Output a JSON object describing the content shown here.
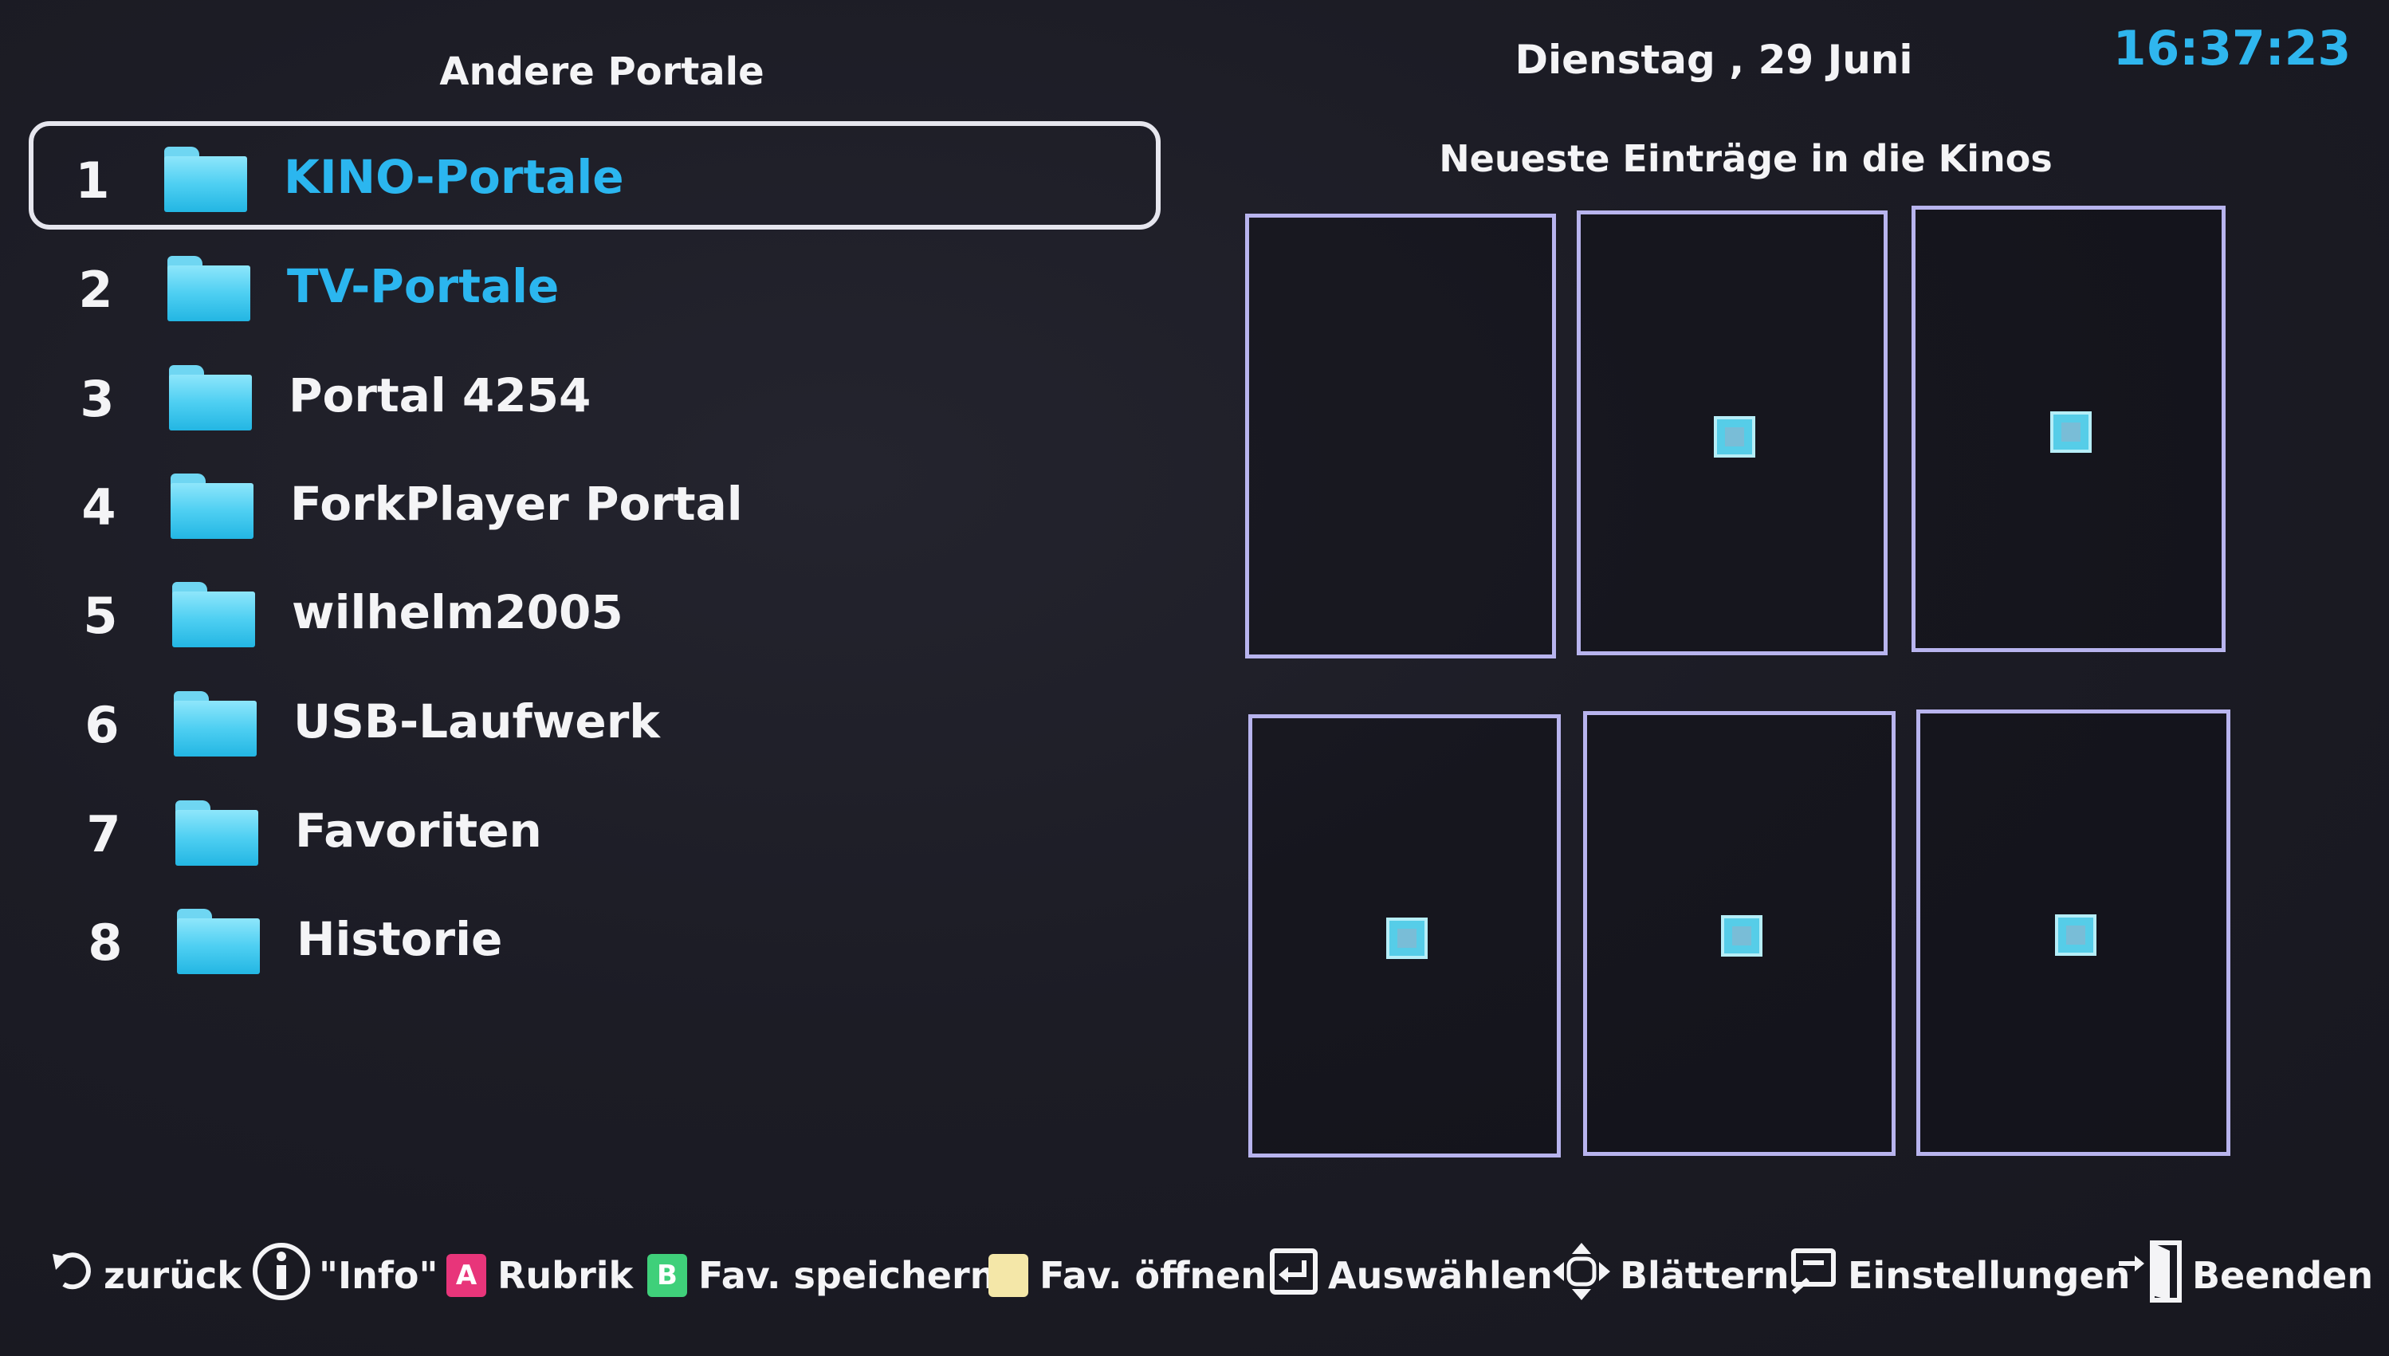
{
  "header": {
    "left_title": "Andere Portale",
    "date": "Dienstag , 29  Juni",
    "time": "16:37:23"
  },
  "list": {
    "items": [
      {
        "number": "1",
        "label": "KINO-Portale",
        "icon": "folder-icon",
        "highlight": true
      },
      {
        "number": "2",
        "label": "TV-Portale",
        "icon": "folder-icon",
        "highlight": true
      },
      {
        "number": "3",
        "label": "Portal 4254",
        "icon": "folder-icon",
        "highlight": false
      },
      {
        "number": "4",
        "label": "ForkPlayer Portal",
        "icon": "folder-icon",
        "highlight": false
      },
      {
        "number": "5",
        "label": "wilhelm2005",
        "icon": "folder-icon",
        "highlight": false
      },
      {
        "number": "6",
        "label": "USB-Laufwerk",
        "icon": "folder-icon",
        "highlight": false
      },
      {
        "number": "7",
        "label": "Favoriten",
        "icon": "folder-icon",
        "highlight": false
      },
      {
        "number": "8",
        "label": "Historie",
        "icon": "folder-icon",
        "highlight": false
      }
    ],
    "selected_index": 0
  },
  "right_panel": {
    "title": "Neueste Einträge in die Kinos",
    "posters": [
      {
        "has_thumbnail": false
      },
      {
        "has_thumbnail": true
      },
      {
        "has_thumbnail": true
      },
      {
        "has_thumbnail": true
      },
      {
        "has_thumbnail": true
      },
      {
        "has_thumbnail": true
      }
    ]
  },
  "bottom_bar": {
    "back": {
      "icon": "back-arrow-icon",
      "label": "zurück"
    },
    "info": {
      "icon": "info-icon",
      "label": "\"Info\""
    },
    "red": {
      "key": "A",
      "label": "Rubrik",
      "color": "#e8357a"
    },
    "green": {
      "key": "B",
      "label": "Fav. speichern",
      "color": "#3fd07a"
    },
    "yellow": {
      "key": "",
      "label": "Fav. öffnen",
      "color": "#f4e7a8"
    },
    "select": {
      "icon": "enter-icon",
      "label": "Auswählen"
    },
    "navigate": {
      "icon": "dpad-icon",
      "label": "Blättern"
    },
    "settings": {
      "icon": "settings-icon",
      "label": "Einstellungen"
    },
    "exit": {
      "icon": "exit-door-icon",
      "label": "Beenden"
    }
  },
  "colors": {
    "accent": "#2bb6ef",
    "folder": "#4ecff2",
    "poster_border": "#b8b4ee",
    "background": "#1c1c25"
  }
}
